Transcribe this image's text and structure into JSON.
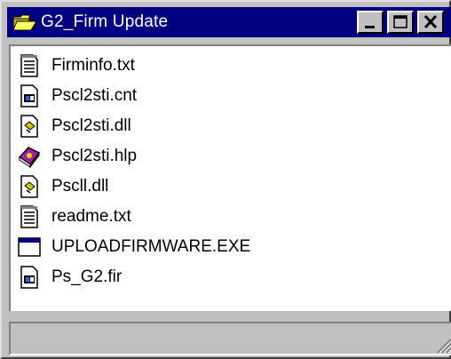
{
  "window": {
    "title": "G2_Firm Update",
    "title_icon": "folder-open-icon",
    "buttons": {
      "minimize": "minimize-icon",
      "maximize": "maximize-icon",
      "close": "close-icon"
    }
  },
  "files": [
    {
      "name": "Firminfo.txt",
      "icon": "text-file-icon"
    },
    {
      "name": "Pscl2sti.cnt",
      "icon": "help-contents-file-icon"
    },
    {
      "name": "Pscl2sti.dll",
      "icon": "dll-file-icon"
    },
    {
      "name": "Pscl2sti.hlp",
      "icon": "help-book-icon"
    },
    {
      "name": "Pscll.dll",
      "icon": "dll-file-icon"
    },
    {
      "name": "readme.txt",
      "icon": "text-file-icon"
    },
    {
      "name": "UPLOADFIRMWARE.EXE",
      "icon": "application-exe-icon"
    },
    {
      "name": "Ps_G2.fir",
      "icon": "generic-file-icon"
    }
  ],
  "statusbar": {
    "text": "",
    "grip_icon": "resize-grip-icon"
  },
  "colors": {
    "titlebar": "#000080",
    "face": "#c0c0c0",
    "content_background": "#ffffff"
  }
}
